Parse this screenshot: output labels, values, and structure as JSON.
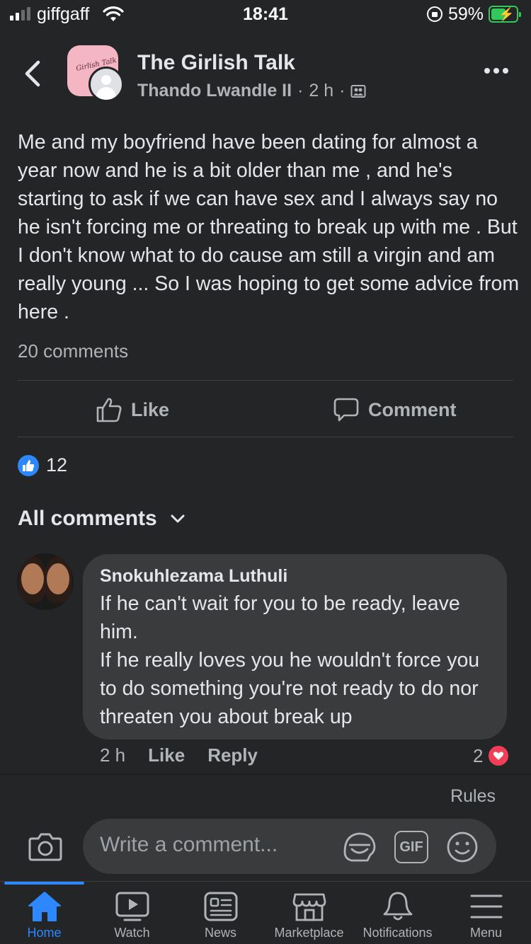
{
  "status_bar": {
    "carrier": "giffgaff",
    "time": "18:41",
    "battery_percent": "59%",
    "battery_level": 0.59,
    "charging": true
  },
  "header": {
    "group_name": "The Girlish Talk",
    "author": "Thando Lwandle II",
    "separator": "·",
    "time_ago": "2 h",
    "group_avatar_script": "Girlish Talk"
  },
  "post": {
    "text": "Me and my boyfriend have been dating for almost a year now and he is a bit older than me , and he's starting to ask if we can have sex and I always say no he isn't forcing me or threating to break up with me . But I don't know what to do cause am still a virgin and am really young ... So I was hoping to get some advice from here .",
    "comments_count_label": "20 comments",
    "like_label": "Like",
    "comment_label": "Comment",
    "reaction_count": "12"
  },
  "comments_section": {
    "heading": "All comments",
    "comments": [
      {
        "author": "Snokuhlezama Luthuli",
        "lines": [
          "If he can't wait for you to be ready, leave him.",
          "If he really loves you he wouldn't force you to do something you're not ready to do nor threaten you about break up"
        ],
        "time_ago": "2 h",
        "like_label": "Like",
        "reply_label": "Reply",
        "reaction_count": "2",
        "reaction_icon": "heart-icon"
      }
    ]
  },
  "composer": {
    "rules_label": "Rules",
    "placeholder": "Write a comment...",
    "gif_label": "GIF"
  },
  "tabbar": {
    "tabs": [
      {
        "label": "Home",
        "icon": "home-icon",
        "active": true
      },
      {
        "label": "Watch",
        "icon": "watch-icon",
        "active": false
      },
      {
        "label": "News",
        "icon": "news-icon",
        "active": false
      },
      {
        "label": "Marketplace",
        "icon": "marketplace-icon",
        "active": false
      },
      {
        "label": "Notifications",
        "icon": "bell-icon",
        "active": false
      },
      {
        "label": "Menu",
        "icon": "menu-icon",
        "active": false
      }
    ]
  },
  "colors": {
    "background": "#242526",
    "surface": "#3a3b3c",
    "accent": "#2d88ff",
    "heart": "#f33e58",
    "battery": "#34c759"
  }
}
